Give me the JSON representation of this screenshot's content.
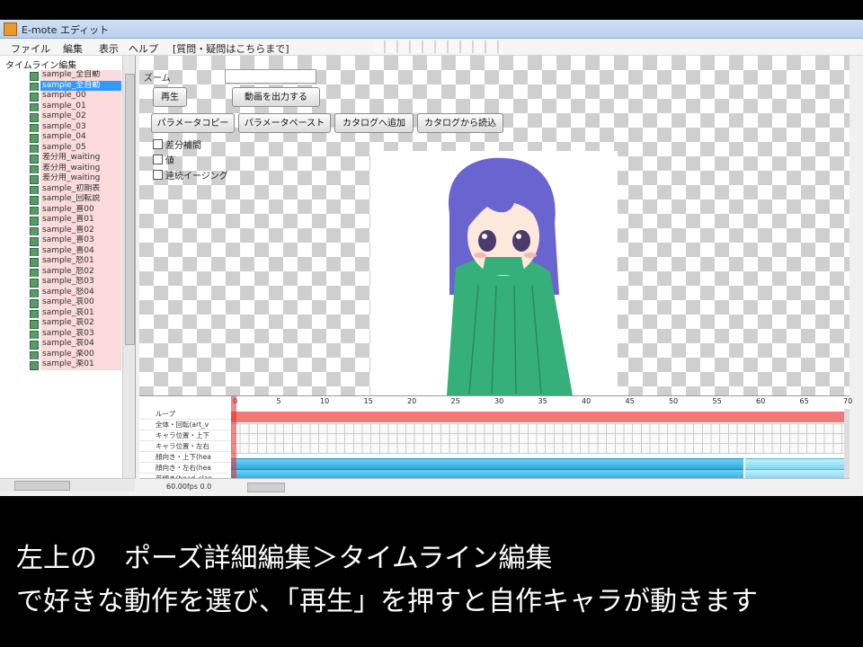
{
  "window": {
    "title": "E-mote エディット"
  },
  "menu": [
    {
      "label": "ファイル"
    },
    {
      "label": "編集"
    },
    {
      "label": "表示"
    },
    {
      "label": "ヘルプ"
    },
    {
      "label": "[質問・疑問はこちらまで]"
    }
  ],
  "tree": {
    "root": "タイムライン編集",
    "items": [
      "sample_全自動",
      "sample_全自動",
      "sample_00",
      "sample_01",
      "sample_02",
      "sample_03",
      "sample_04",
      "sample_05",
      "差分用_waiting",
      "差分用_waiting",
      "差分用_waiting",
      "sample_初期表",
      "sample_回転説",
      "sample_喜00",
      "sample_喜01",
      "sample_喜02",
      "sample_喜03",
      "sample_喜04",
      "sample_怒01",
      "sample_怒02",
      "sample_怒03",
      "sample_怒04",
      "sample_哀00",
      "sample_哀01",
      "sample_哀02",
      "sample_哀03",
      "sample_哀04",
      "sample_楽00",
      "sample_楽01"
    ],
    "selected_index": 1
  },
  "preview": {
    "zoom_label": "ズーム",
    "buttons": {
      "play": "再生",
      "export_video": "動画を出力する",
      "param_copy": "パラメータコピー",
      "param_paste": "パラメータペースト",
      "catalog_add": "カタログへ追加",
      "catalog_load": "カタログから読込"
    },
    "checks": [
      "差分補間",
      "値",
      "連続イージング"
    ]
  },
  "timeline": {
    "ruler": [
      "0",
      "5",
      "10",
      "15",
      "20",
      "25",
      "30",
      "35",
      "40",
      "45",
      "50",
      "55",
      "60",
      "65",
      "70"
    ],
    "rows": [
      "ループ",
      "全体・回転(art_v",
      "キャラ位置・上下",
      "キャラ位置・左右",
      "顔向き・上下(hea",
      "顔向き・左右(hea",
      "首傾き(head_slan"
    ],
    "status": "60.00fps  0.0"
  },
  "caption": {
    "line1": "左上の　ポーズ詳細編集＞タイムライン編集",
    "line2": "で好きな動作を選び、「再生」を押すと自作キャラが動きます"
  },
  "character": {
    "hair": "#6a64d0",
    "robe": "#35b07a",
    "skin": "#fde8dc"
  }
}
